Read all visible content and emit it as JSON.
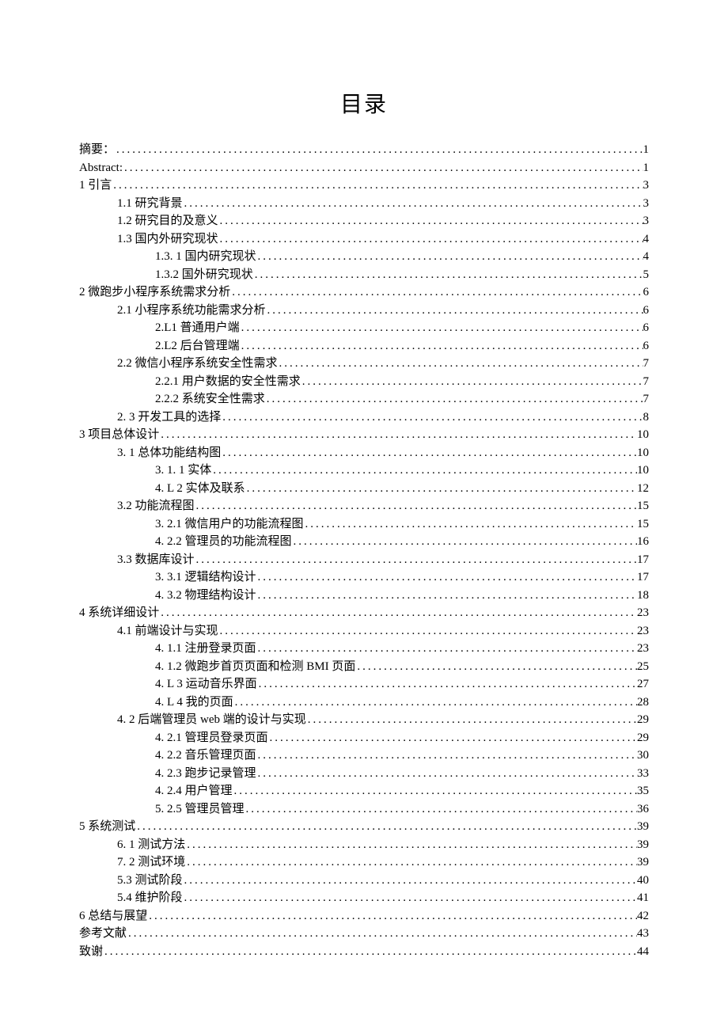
{
  "title": "目录",
  "entries": [
    {
      "level": 1,
      "label": "摘要：",
      "page": "1"
    },
    {
      "level": 1,
      "label": "Abstract:",
      "page": "1"
    },
    {
      "level": 1,
      "label": "1 引言",
      "page": "3"
    },
    {
      "level": 2,
      "label": "1.1 研究背景",
      "page": "3"
    },
    {
      "level": 2,
      "label": "1.2   研究目的及意义",
      "page": "3"
    },
    {
      "level": 2,
      "label": "1.3   国内外研究现状",
      "page": "4"
    },
    {
      "level": 3,
      "label": "1.3.  1 国内研究现状",
      "page": "4"
    },
    {
      "level": 3,
      "label": "1.3.2 国外研究现状",
      "page": "5"
    },
    {
      "level": 1,
      "label": "2 微跑步小程序系统需求分析",
      "page": "6"
    },
    {
      "level": 2,
      "label": "2.1 小程序系统功能需求分析",
      "page": "6"
    },
    {
      "level": 3,
      "label": "2.L1 普通用户端",
      "page": "6"
    },
    {
      "level": 3,
      "label": "2.L2 后台管理端",
      "page": "6"
    },
    {
      "level": 2,
      "label": "2.2 微信小程序系统安全性需求",
      "page": "7"
    },
    {
      "level": 3,
      "label": "2.2.1 用户数据的安全性需求",
      "page": "7"
    },
    {
      "level": 3,
      "label": "2.2.2 系统安全性需求",
      "page": "7"
    },
    {
      "level": 2,
      "label": "2.  3 开发工具的选择",
      "page": "8"
    },
    {
      "level": 1,
      "label": "3 项目总体设计",
      "page": "10"
    },
    {
      "level": 2,
      "label": "3.  1 总体功能结构图",
      "page": "10"
    },
    {
      "level": 3,
      "label": "3.  1.  1 实体",
      "page": "10"
    },
    {
      "level": 3,
      "label": "4.  L 2 实体及联系",
      "page": "12"
    },
    {
      "level": 2,
      "label": "3.2   功能流程图",
      "page": "15"
    },
    {
      "level": 3,
      "label": "3.  2.1 微信用户的功能流程图",
      "page": "15"
    },
    {
      "level": 3,
      "label": "4.  2.2 管理员的功能流程图",
      "page": "16"
    },
    {
      "level": 2,
      "label": "3.3   数据库设计",
      "page": "17"
    },
    {
      "level": 3,
      "label": "3.  3.1 逻辑结构设计",
      "page": "17"
    },
    {
      "level": 3,
      "label": "4.  3.2 物理结构设计",
      "page": "18"
    },
    {
      "level": 1,
      "label": "4 系统详细设计",
      "page": "23"
    },
    {
      "level": 2,
      "label": "4.1 前端设计与实现",
      "page": "23"
    },
    {
      "level": 3,
      "label": "4.  1.1 注册登录页面",
      "page": "23"
    },
    {
      "level": 3,
      "label": "4.  1.2 微跑步首页页面和检测 BMI 页面",
      "page": "25"
    },
    {
      "level": 3,
      "label": "4.  L 3 运动音乐界面",
      "page": "27"
    },
    {
      "level": 3,
      "label": "4.  L 4 我的页面",
      "page": "28"
    },
    {
      "level": 2,
      "label": "4.  2 后端管理员 web 端的设计与实现",
      "page": "29"
    },
    {
      "level": 3,
      "label": "4.  2.1 管理员登录页面",
      "page": "29"
    },
    {
      "level": 3,
      "label": "4.  2.2 音乐管理页面",
      "page": "30"
    },
    {
      "level": 3,
      "label": "4.  2.3 跑步记录管理",
      "page": "33"
    },
    {
      "level": 3,
      "label": "4.  2.4 用户管理",
      "page": "35"
    },
    {
      "level": 3,
      "label": "5.  2.5 管理员管理",
      "page": "36"
    },
    {
      "level": 1,
      "label": "5 系统测试",
      "page": "39"
    },
    {
      "level": 2,
      "label": "6.  1 测试方法",
      "page": "39"
    },
    {
      "level": 2,
      "label": "7.  2 测试环境",
      "page": "39"
    },
    {
      "level": 2,
      "label": "5.3 测试阶段",
      "page": "40"
    },
    {
      "level": 2,
      "label": "5.4 维护阶段",
      "page": "41"
    },
    {
      "level": 1,
      "label": "6 总结与展望",
      "page": "42"
    },
    {
      "level": 1,
      "label": "参考文献",
      "page": "43"
    },
    {
      "level": 1,
      "label": "致谢",
      "page": "44"
    }
  ]
}
